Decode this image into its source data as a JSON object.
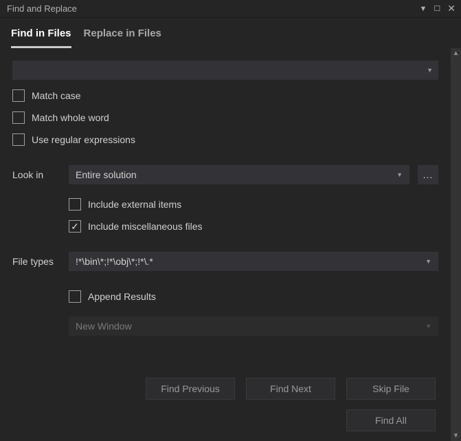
{
  "window": {
    "title": "Find and Replace"
  },
  "tabs": {
    "find": "Find in Files",
    "replace": "Replace in Files",
    "active": "find"
  },
  "search": {
    "value": ""
  },
  "options": {
    "match_case": "Match case",
    "match_whole_word": "Match whole word",
    "use_regex": "Use regular expressions"
  },
  "lookin": {
    "label": "Look in",
    "value": "Entire solution",
    "browse": "...",
    "include_external": "Include external items",
    "include_misc": "Include miscellaneous files"
  },
  "filetypes": {
    "label": "File types",
    "value": "!*\\bin\\*;!*\\obj\\*;!*\\.*"
  },
  "results": {
    "append": "Append Results",
    "window": "New Window"
  },
  "buttons": {
    "find_previous": "Find Previous",
    "find_next": "Find Next",
    "skip_file": "Skip File",
    "find_all": "Find All"
  }
}
